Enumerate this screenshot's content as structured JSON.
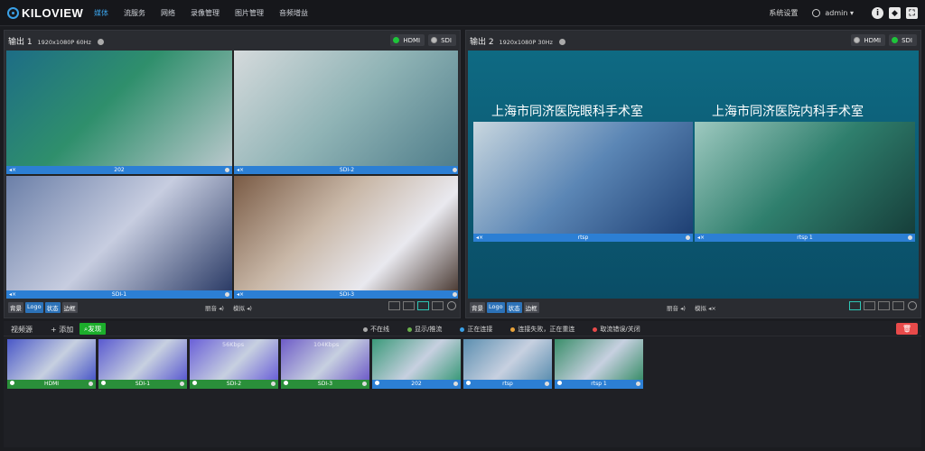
{
  "brand": {
    "name": "KILOVIEW"
  },
  "nav": [
    "媒体",
    "流服务",
    "网络",
    "录像管理",
    "图片管理",
    "音频增益"
  ],
  "header": {
    "settings": "系统设置",
    "user": "admin"
  },
  "output1": {
    "title": "输出 1",
    "res": "1920x1080P 60Hz",
    "hdmi": "HDMI",
    "sdi": "SDI",
    "cells": [
      "202",
      "SDI-2",
      "SDI-1",
      "SDI-3"
    ],
    "tags": [
      "背景",
      "Logo",
      "状态",
      "边框"
    ],
    "vol1": "丽音",
    "vol2": "模拟"
  },
  "output2": {
    "title": "输出 2",
    "res": "1920x1080P 30Hz",
    "hdmi": "HDMI",
    "sdi": "SDI",
    "room1": "上海市同济医院眼科手术室",
    "room2": "上海市同济医院内科手术室",
    "cells": [
      "rtsp",
      "rtsp 1"
    ],
    "tags": [
      "背景",
      "Logo",
      "状态",
      "边框"
    ],
    "vol1": "丽音",
    "vol2": "模拟"
  },
  "sources": {
    "tab": "视频源",
    "add": "+ 添加",
    "find": "发现",
    "legend": [
      {
        "text": "不在线",
        "color": "#aaaaaa"
      },
      {
        "text": "显示/推流",
        "color": "#6ab04c"
      },
      {
        "text": "正在连接",
        "color": "#3aa0e6"
      },
      {
        "text": "连接失败，正在重连",
        "color": "#e8a23a"
      },
      {
        "text": "取流错误/关闭",
        "color": "#e84a4a"
      }
    ],
    "items": [
      {
        "name": "HDMI",
        "kbps": "",
        "cap": "g",
        "bg": "#4a58c8"
      },
      {
        "name": "SDI-1",
        "kbps": "",
        "cap": "g",
        "bg": "#5a5ad0"
      },
      {
        "name": "SDI-2",
        "kbps": "56Kbps",
        "cap": "g",
        "bg": "#6a60d8"
      },
      {
        "name": "SDI-3",
        "kbps": "104Kbps",
        "cap": "g",
        "bg": "#6e5cc8"
      },
      {
        "name": "202",
        "kbps": "",
        "cap": "b",
        "bg": "#3b9a7a"
      },
      {
        "name": "rtsp",
        "kbps": "",
        "cap": "b",
        "bg": "#5c8fb0"
      },
      {
        "name": "rtsp 1",
        "kbps": "",
        "cap": "b",
        "bg": "#3a8e6a"
      }
    ]
  }
}
